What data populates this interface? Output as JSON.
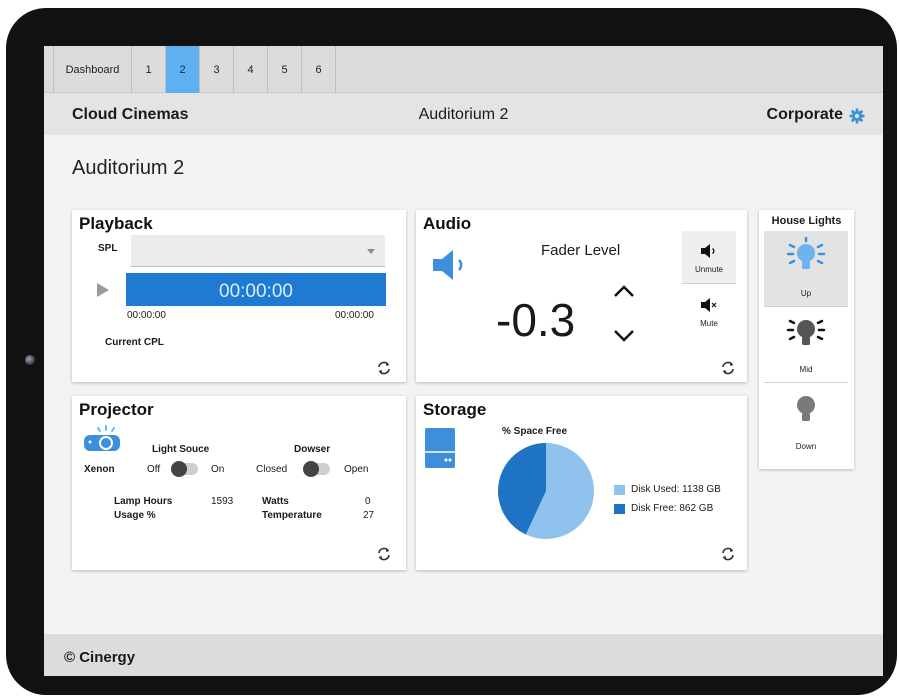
{
  "tabs": [
    {
      "label": "Dashboard",
      "active": false
    },
    {
      "label": "1",
      "active": false
    },
    {
      "label": "2",
      "active": true
    },
    {
      "label": "3",
      "active": false
    },
    {
      "label": "4",
      "active": false
    },
    {
      "label": "5",
      "active": false
    },
    {
      "label": "6",
      "active": false
    }
  ],
  "header": {
    "brand": "Cloud Cinemas",
    "title": "Auditorium 2",
    "user": "Corporate",
    "settings_icon": "gear-icon"
  },
  "page_title": "Auditorium 2",
  "playback": {
    "title": "Playback",
    "spl_label": "SPL",
    "spl_value": "",
    "timecode": "00:00:00",
    "time_start": "00:00:00",
    "time_end": "00:00:00",
    "cpl_label": "Current CPL"
  },
  "audio": {
    "title": "Audio",
    "fader_label": "Fader Level",
    "fader_value": "-0.3",
    "unmute_label": "Unmute",
    "mute_label": "Mute"
  },
  "house_lights": {
    "title": "House Lights",
    "up": "Up",
    "mid": "Mid",
    "down": "Down",
    "active": "Up"
  },
  "projector": {
    "title": "Projector",
    "lamp_type": "Xenon",
    "light_source_label": "Light Souce",
    "off": "Off",
    "on": "On",
    "dowser_label": "Dowser",
    "closed": "Closed",
    "open": "Open",
    "lamp_hours_label": "Lamp Hours",
    "lamp_hours_value": "1593",
    "usage_label": "Usage %",
    "watts_label": "Watts",
    "watts_value": "0",
    "temperature_label": "Temperature",
    "temperature_value": "27"
  },
  "storage": {
    "title": "Storage",
    "chart_title": "% Space Free",
    "used_label": "Disk Used: 1138 GB",
    "free_label": "Disk Free: 862 GB",
    "used_gb": 1138,
    "free_gb": 862,
    "used_color": "#8fc3ee",
    "free_color": "#1f73c4"
  },
  "footer": {
    "text": "© Cinergy"
  },
  "colors": {
    "accent": "#5fb0f0",
    "timecode_bg": "#1f7bd1",
    "icon_blue": "#3d8fdc"
  }
}
